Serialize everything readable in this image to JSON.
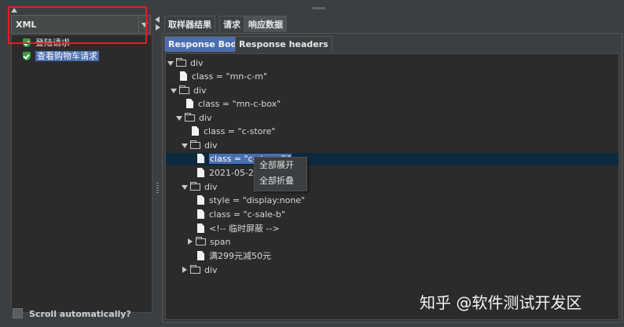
{
  "left_panel": {
    "renderer_value": "XML",
    "samples": [
      {
        "label": "登陆请求",
        "selected": false
      },
      {
        "label": "查看购物车请求",
        "selected": true
      }
    ],
    "scroll_auto_label": "Scroll automatically?"
  },
  "result_tabs": [
    {
      "label": "取样器结果"
    },
    {
      "label": "请求"
    },
    {
      "label": "响应数据"
    }
  ],
  "response_tabs": [
    {
      "label": "Response Body"
    },
    {
      "label": "Response headers"
    }
  ],
  "xml_tree": [
    {
      "text": "div"
    },
    {
      "text": "class = \"mn-c-m\""
    },
    {
      "text": "div"
    },
    {
      "text": "class = \"mn-c-box\""
    },
    {
      "text": "div"
    },
    {
      "text": "class = \"c-store\""
    },
    {
      "text": "div"
    },
    {
      "text": "class = \"c-store-ft\""
    },
    {
      "text": "2021-05-22"
    },
    {
      "text": "div"
    },
    {
      "text": "style = \"display:none\""
    },
    {
      "text": "class = \"c-sale-b\""
    },
    {
      "text": "<!-- 临时屏蔽 -->"
    },
    {
      "text": "span"
    },
    {
      "text": "满299元减50元"
    },
    {
      "text": "div"
    }
  ],
  "context_menu": {
    "items": [
      {
        "label": "全部展开"
      },
      {
        "label": "全部折叠"
      }
    ]
  },
  "watermark": "知乎 @软件测试开发区",
  "icons": [
    "shield-check-icon",
    "folder-icon",
    "file-icon",
    "chevron-down-icon",
    "chevron-right-icon"
  ],
  "colors": {
    "selection": "#4b6eaf",
    "selected_row": "#0d293e",
    "highlight_box": "#e02020",
    "success": "#3aa042"
  }
}
